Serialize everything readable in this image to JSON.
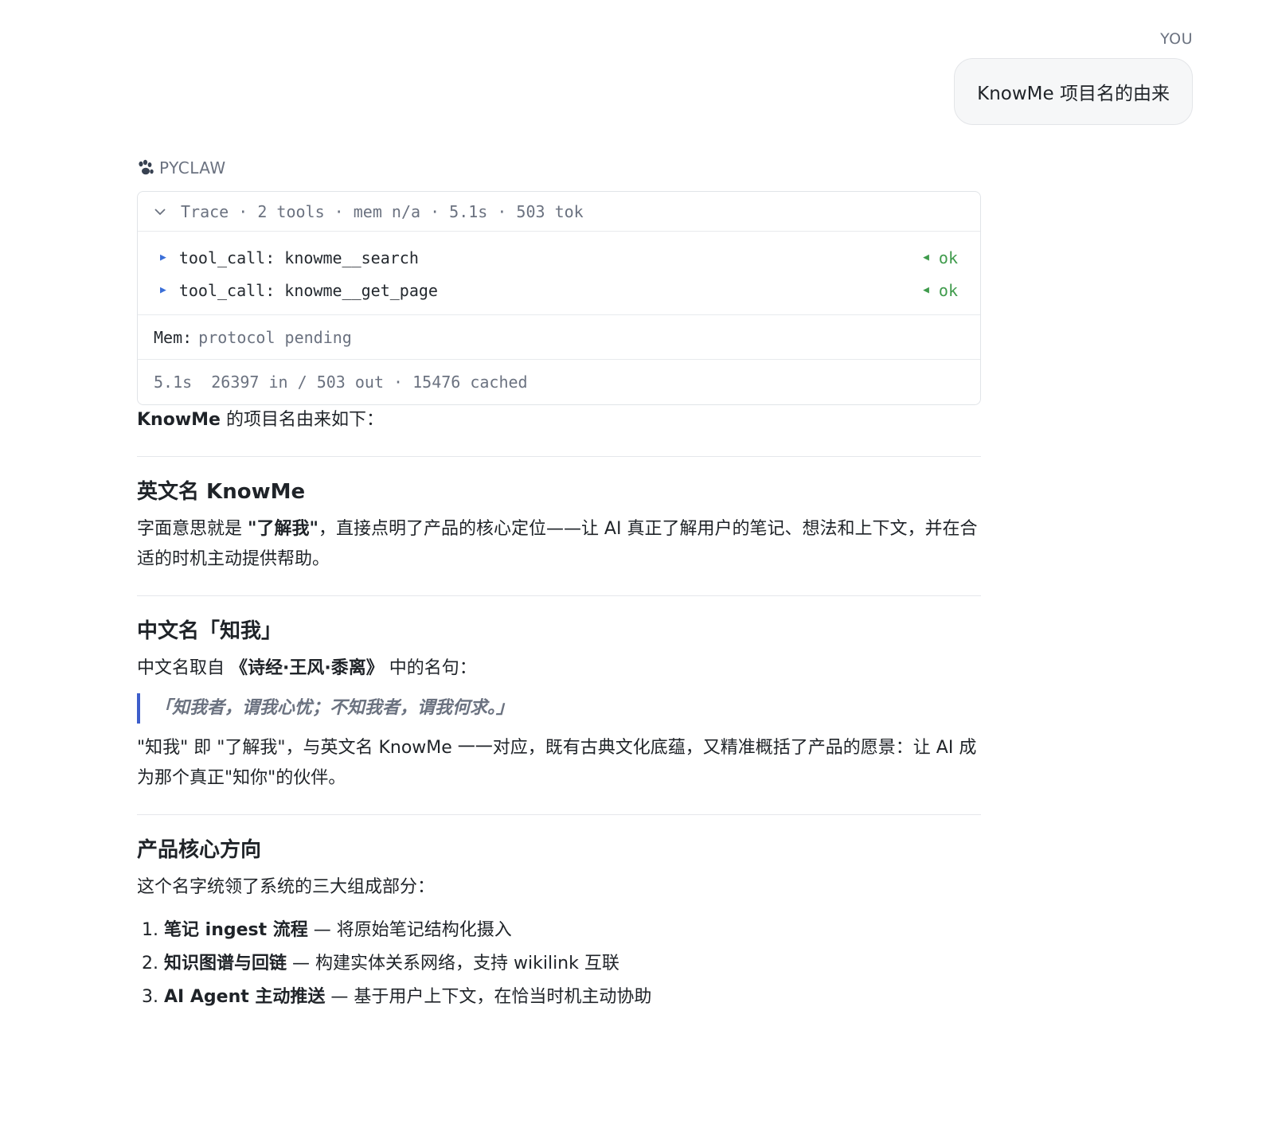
{
  "user": {
    "label": "YOU",
    "message": "KnowMe 项目名的由来"
  },
  "assistant": {
    "label": "PYCLAW",
    "icon": "paw-icon",
    "trace": {
      "header": "Trace · 2 tools · mem n/a · 5.1s · 503 tok",
      "calls": [
        {
          "name": "tool_call: knowme__search",
          "status": "ok"
        },
        {
          "name": "tool_call: knowme__get_page",
          "status": "ok"
        }
      ],
      "mem_key": "Mem:",
      "mem_value": "protocol pending",
      "stats": "5.1s  26397 in / 503 out · 15476 cached"
    },
    "intro_bold": "KnowMe",
    "intro_rest": " 的项目名由来如下：",
    "section1": {
      "title": "英文名 KnowMe",
      "text_a": "字面意思就是 ",
      "text_bold": "\"了解我\"",
      "text_b": "，直接点明了产品的核心定位——让 AI 真正了解用户的笔记、想法和上下文，并在合适的时机主动提供帮助。"
    },
    "section2": {
      "title": "中文名「知我」",
      "text_a": "中文名取自 ",
      "text_bold": "《诗经·王风·黍离》",
      "text_b": " 中的名句：",
      "quote": "「知我者，谓我心忧；不知我者，谓我何求。」",
      "text2": "\"知我\" 即 \"了解我\"，与英文名 KnowMe 一一对应，既有古典文化底蕴，又精准概括了产品的愿景：让 AI 成为那个真正\"知你\"的伙伴。"
    },
    "section3": {
      "title": "产品核心方向",
      "text": "这个名字统领了系统的三大组成部分：",
      "items": [
        {
          "bold": "笔记 ingest 流程",
          "rest": " — 将原始笔记结构化摄入"
        },
        {
          "bold": "知识图谱与回链",
          "rest": " — 构建实体关系网络，支持 wikilink 互联"
        },
        {
          "bold": "AI Agent 主动推送",
          "rest": " — 基于用户上下文，在恰当时机主动协助"
        }
      ]
    }
  },
  "colors": {
    "accent_blue": "#3b6fd8",
    "ok_green": "#3f9b4c",
    "quote_bar": "#3d5ecb"
  }
}
